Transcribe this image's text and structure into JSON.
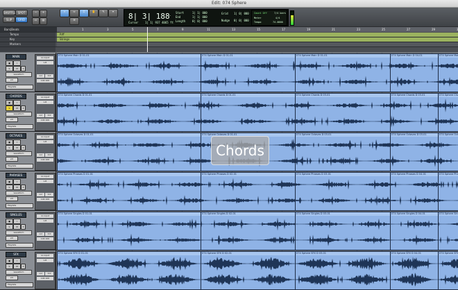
{
  "window": {
    "title": "Edit: 074 Sphere",
    "traffic_colors": [
      "#f45b57",
      "#f7bd3b",
      "#3fc74b"
    ]
  },
  "toolbar": {
    "mode_buttons": [
      "SHUFFLE",
      "SPOT",
      "SLIP",
      "GRID"
    ],
    "counter_main": "8| 3| 188",
    "counter_suffix": "-",
    "start_label": "Start",
    "end_label": "End",
    "length_label": "Length",
    "start_value": "1| 1| 000",
    "end_value": "1| 1| 000",
    "length_value": "0| 0| 000",
    "cursor_label": "Cursor",
    "cursor_value": "1| 1| 937",
    "cursor_extra": "4065 ft",
    "grid_label": "Grid",
    "grid_value": "1| 0| 000",
    "nudge_label": "Nudge",
    "nudge_value": "0| 0| 000",
    "count_off": "Count Off",
    "meter_label": "Meter",
    "tempo_label": "Tempo",
    "meter_value": "7/4 bars",
    "meter_sig": "4/4",
    "tempo_value": "74.0000"
  },
  "rulers": {
    "labels": [
      "Bars|Beats",
      "Tempo",
      "Key",
      "Markers"
    ],
    "bars": [
      "1",
      "3",
      "5",
      "7",
      "9",
      "11",
      "13",
      "15",
      "17",
      "19",
      "21",
      "23",
      "25",
      "27",
      "29",
      "31"
    ],
    "marker_a": "Riff",
    "marker_b": "Strings"
  },
  "tracks": [
    {
      "name": "MAIN",
      "clip_names": [
        "074 Sphere Main D 01-01",
        "074 Sphere Main D 01-01",
        "074 Sphere Main D 01-01",
        "074 Sphere Main D 04-01",
        "074 Sphere Main D 04-01",
        "074 Sphere Main D 04-01"
      ]
    },
    {
      "name": "CHORDS",
      "clip_names": [
        "074 Sphere Chords D 01-01",
        "074 Sphere Chords D 01-01",
        "074 Sphere Chords D 03-01",
        "074 Sphere Chords D 03-01",
        "074 Sphere Chords D 04-01",
        "074 Sphere Chords D 06-01"
      ]
    },
    {
      "name": "OCTAVES",
      "clip_names": [
        "074 Sphere Octaves D 01-01",
        "074 Sphere Octaves D 01-01",
        "074 Sphere Octaves D 03-01",
        "074 Sphere Octaves D 03-01",
        "074 Sphere Octaves D 04-01",
        "074 Sphere Octaves D 06-01"
      ]
    },
    {
      "name": "PHRASES",
      "clip_names": [
        "074 Sphere Phrases D 01-01",
        "074 Sphere Phrases D 02-01",
        "074 Sphere Phrases D 03-01",
        "074 Sphere Phrases D 04-01",
        "074 Sphere Phrases D 05-01",
        "074 Sphere Phrases D 06-01"
      ]
    },
    {
      "name": "SINGLES",
      "clip_names": [
        "074 Sphere Singles D 01-01",
        "074 Sphere Singles D 02-01",
        "074 Sphere Singles D 03-01",
        "074 Sphere Singles D 04-01",
        "074 Sphere Singles D 05-01",
        "074 Sphere Singles D 06-01"
      ]
    },
    {
      "name": "SFX",
      "clip_names": [
        "074 Sphere SFX D 01-01",
        "074 Sphere SFX D 02-01",
        "074 Sphere SFX D 03-01",
        "074 Sphere SFX D 04-01",
        "074 Sphere SFX D 05-01",
        "074 Sphere SFX D 06-01"
      ]
    }
  ],
  "track_header": {
    "input": "no input",
    "output": "L-R",
    "mode": "waveform",
    "vol": "vol",
    "vol_value": "0.0",
    "pan_value": "100 100",
    "playlist": "Playlists"
  },
  "overlay_label": "Chords",
  "colors": {
    "clip_fill": "#8fb3e6",
    "clip_header": "#a8c6ef",
    "waveform": "#1f3557",
    "track_bg": "#8a8e94"
  }
}
